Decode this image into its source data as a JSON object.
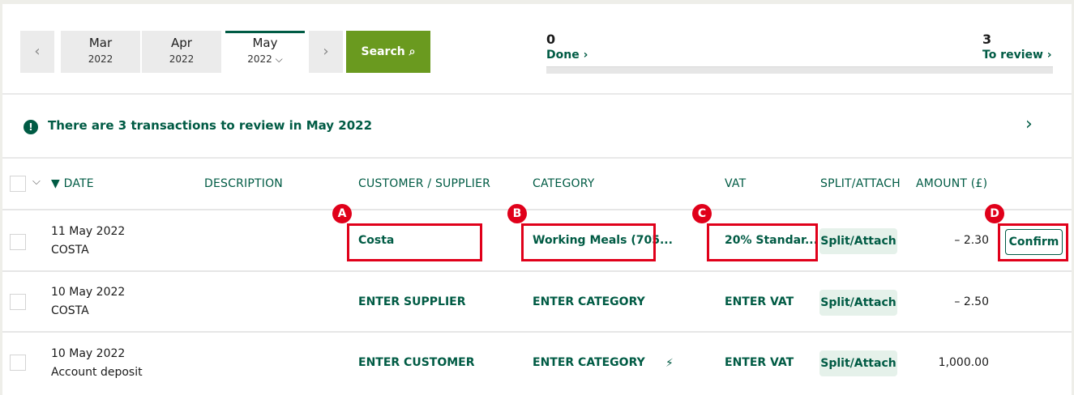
{
  "month_nav": {
    "prev_icon": "chevron-left-icon",
    "next_icon": "chevron-right-icon",
    "months": [
      {
        "month": "Mar",
        "year": "2022"
      },
      {
        "month": "Apr",
        "year": "2022"
      },
      {
        "month": "May",
        "year": "2022 ⌵"
      }
    ],
    "search_label": "Search",
    "search_icon": "⌕"
  },
  "stats": {
    "done_count": "0",
    "done_label": "Done ›",
    "review_count": "3",
    "review_label": "To review ›",
    "progress_fraction": 0
  },
  "banner": {
    "icon": "!",
    "text": "There are 3 transactions to review in May 2022",
    "chevron": "›"
  },
  "table": {
    "headers": {
      "date": "▼ DATE",
      "description": "DESCRIPTION",
      "party": "CUSTOMER / SUPPLIER",
      "category": "CATEGORY",
      "vat": "VAT",
      "split": "SPLIT/ATTACH",
      "amount": "AMOUNT (£)"
    },
    "rows": [
      {
        "date": "11 May 2022",
        "description": "COSTA",
        "party": "Costa",
        "category": "Working Meals (705...",
        "vat": "20% Standar...",
        "split": "Split/Attach",
        "amount": "– 2.30",
        "action": "Confirm"
      },
      {
        "date": "10 May 2022",
        "description": "COSTA",
        "party": "ENTER SUPPLIER",
        "category": "ENTER CATEGORY",
        "vat": "ENTER VAT",
        "split": "Split/Attach",
        "amount": "– 2.50"
      },
      {
        "date": "10 May 2022",
        "description": "Account deposit",
        "party": "ENTER CUSTOMER",
        "category": "ENTER CATEGORY",
        "vat": "ENTER VAT",
        "split": "Split/Attach",
        "amount": "1,000.00",
        "flag": "⚡"
      }
    ]
  },
  "annotations": [
    "A",
    "B",
    "C",
    "D"
  ],
  "colors": {
    "brand_green": "#005b44",
    "search_green": "#6a9a1f",
    "annotation_red": "#e0001a"
  }
}
